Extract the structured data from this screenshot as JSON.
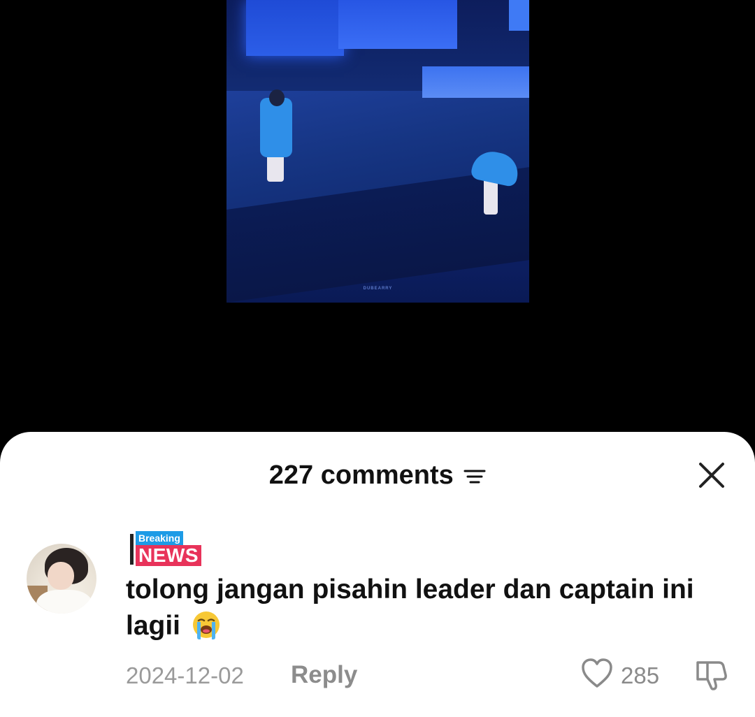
{
  "video": {
    "watermark": "DUBEARRY"
  },
  "comments_sheet": {
    "count_label": "227 comments",
    "sort_icon": "sort-lines-icon",
    "close_icon": "close-icon"
  },
  "comment": {
    "badge": {
      "top": "Breaking",
      "bottom": "NEWS"
    },
    "text": "tolong jangan pisahin leader dan captain ini lagii",
    "emoji": "loudly-crying-face-icon",
    "date": "2024-12-02",
    "reply_label": "Reply",
    "like_count": "285"
  },
  "colors": {
    "badge_blue": "#1d9be6",
    "badge_pink": "#e8335a",
    "muted_text": "#9a9a9a"
  }
}
